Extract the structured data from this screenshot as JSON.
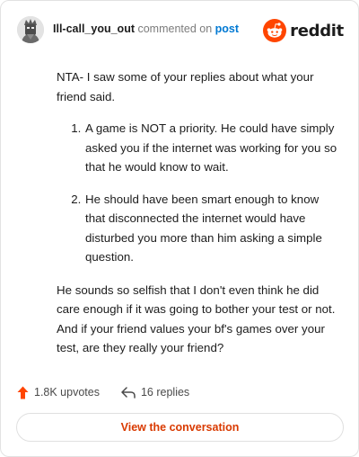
{
  "header": {
    "username": "Ill-call_you_out",
    "action": "commented on",
    "post_link": "post",
    "brand": "reddit",
    "brand_color": "#ff4500"
  },
  "comment": {
    "intro": "NTA- I saw some of your replies about what your friend said.",
    "points": [
      "A game is NOT a priority. He could have simply asked you if the internet was working for you so that he would know to wait.",
      "He should have been smart enough to know that disconnected the internet would have disturbed you more than him asking a simple question."
    ],
    "closing": "He sounds so selfish that I don't even think he did care enough if it was going to bother your test or not. And if your friend values your bf's games over your test, are they really your friend?"
  },
  "stats": {
    "upvotes": "1.8K upvotes",
    "upvote_icon": "upvote-arrow-icon",
    "upvote_color": "#ff4500",
    "replies": "16 replies",
    "reply_icon": "reply-arrow-icon"
  },
  "cta": {
    "label": "View the conversation",
    "color": "#d93a00"
  }
}
